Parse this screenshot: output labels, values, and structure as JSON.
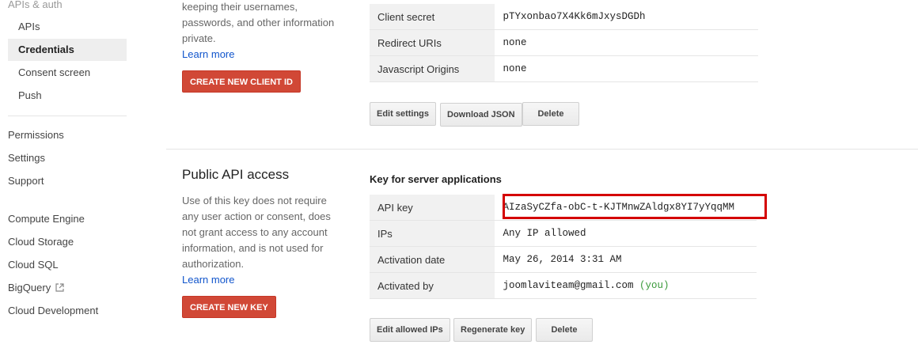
{
  "sidebar": {
    "category": "APIs & auth",
    "sub_items": [
      {
        "label": "APIs"
      },
      {
        "label": "Credentials"
      },
      {
        "label": "Consent screen"
      },
      {
        "label": "Push"
      }
    ],
    "items": [
      {
        "label": "Permissions"
      },
      {
        "label": "Settings"
      },
      {
        "label": "Support"
      },
      {
        "label": "Compute Engine"
      },
      {
        "label": "Cloud Storage"
      },
      {
        "label": "Cloud SQL"
      },
      {
        "label": "BigQuery"
      },
      {
        "label": "Cloud Development"
      }
    ],
    "active_item": "Credentials"
  },
  "oauth": {
    "description": "keeping their usernames, passwords, and other information private.",
    "learn_more": "Learn more",
    "create_button": "CREATE NEW CLIENT ID",
    "table": [
      {
        "key": "Client secret",
        "value": "pTYxonbao7X4Kk6mJxysDGDh"
      },
      {
        "key": "Redirect URIs",
        "value": "none"
      },
      {
        "key": "Javascript Origins",
        "value": "none"
      }
    ],
    "buttons": {
      "edit": "Edit settings",
      "download": "Download JSON",
      "delete": "Delete"
    }
  },
  "public_api": {
    "title": "Public API access",
    "description": "Use of this key does not require any user action or consent, does not grant access to any account information, and is not used for authorization.",
    "learn_more": "Learn more",
    "create_button": "CREATE NEW KEY",
    "key_heading": "Key for server applications",
    "table": [
      {
        "key": "API key",
        "value": "AIzaSyCZfa-obC-t-KJTMnwZAldgx8YI7yYqqMM"
      },
      {
        "key": "IPs",
        "value": "Any IP allowed"
      },
      {
        "key": "Activation date",
        "value": "May 26, 2014 3:31 AM"
      },
      {
        "key": "Activated by",
        "value": "joomlaviteam@gmail.com",
        "suffix": "(you)"
      }
    ],
    "buttons": {
      "edit_ips": "Edit allowed IPs",
      "regenerate": "Regenerate key",
      "delete": "Delete"
    }
  },
  "colors": {
    "primary_red": "#d14836",
    "link_blue": "#1155cc",
    "highlight_red": "#d40000",
    "you_green": "#3a9a3a"
  }
}
